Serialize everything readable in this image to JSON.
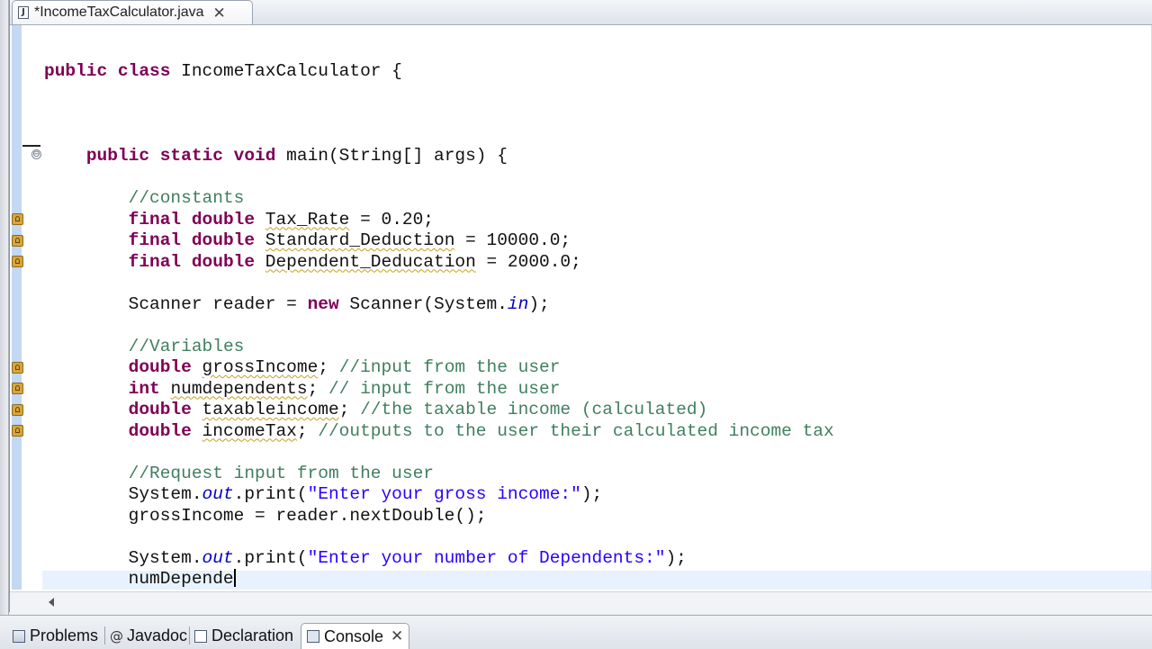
{
  "editor": {
    "tab": {
      "title": "*IncomeTaxCalculator.java",
      "icon": "java-file-icon",
      "close": "✕"
    },
    "fold_glyph": "⊖",
    "code_lines": [
      [
        {
          "t": "public",
          "c": "kw"
        },
        {
          "t": " "
        },
        {
          "t": "class",
          "c": "kw"
        },
        {
          "t": " IncomeTaxCalculator {"
        }
      ],
      [],
      [],
      [],
      [
        {
          "t": "    "
        },
        {
          "t": "public",
          "c": "kw"
        },
        {
          "t": " "
        },
        {
          "t": "static",
          "c": "kw"
        },
        {
          "t": " "
        },
        {
          "t": "void",
          "c": "kw"
        },
        {
          "t": " main(String[] args) {"
        }
      ],
      [],
      [
        {
          "t": "        "
        },
        {
          "t": "//constants",
          "c": "cm"
        }
      ],
      [
        {
          "t": "        "
        },
        {
          "t": "final",
          "c": "kw"
        },
        {
          "t": " "
        },
        {
          "t": "double",
          "c": "kw"
        },
        {
          "t": " "
        },
        {
          "t": "Tax_Rate",
          "c": "sq"
        },
        {
          "t": " = 0.20;"
        }
      ],
      [
        {
          "t": "        "
        },
        {
          "t": "final",
          "c": "kw"
        },
        {
          "t": " "
        },
        {
          "t": "double",
          "c": "kw"
        },
        {
          "t": " "
        },
        {
          "t": "Standard_Deduction",
          "c": "sq"
        },
        {
          "t": " = 10000.0;"
        }
      ],
      [
        {
          "t": "        "
        },
        {
          "t": "final",
          "c": "kw"
        },
        {
          "t": " "
        },
        {
          "t": "double",
          "c": "kw"
        },
        {
          "t": " "
        },
        {
          "t": "Dependent_Deducation",
          "c": "sq"
        },
        {
          "t": " = 2000.0;"
        }
      ],
      [],
      [
        {
          "t": "        Scanner reader = "
        },
        {
          "t": "new",
          "c": "kw"
        },
        {
          "t": " Scanner(System."
        },
        {
          "t": "in",
          "c": "it"
        },
        {
          "t": ");"
        }
      ],
      [],
      [
        {
          "t": "        "
        },
        {
          "t": "//Variables",
          "c": "cm"
        }
      ],
      [
        {
          "t": "        "
        },
        {
          "t": "double",
          "c": "kw"
        },
        {
          "t": " "
        },
        {
          "t": "grossIncome",
          "c": "sq"
        },
        {
          "t": "; "
        },
        {
          "t": "//input from the user",
          "c": "cm"
        }
      ],
      [
        {
          "t": "        "
        },
        {
          "t": "int",
          "c": "kw"
        },
        {
          "t": " "
        },
        {
          "t": "numdependents",
          "c": "sq"
        },
        {
          "t": "; "
        },
        {
          "t": "// input from the user",
          "c": "cm"
        }
      ],
      [
        {
          "t": "        "
        },
        {
          "t": "double",
          "c": "kw"
        },
        {
          "t": " "
        },
        {
          "t": "taxableincome",
          "c": "sq"
        },
        {
          "t": "; "
        },
        {
          "t": "//the taxable income (calculated)",
          "c": "cm"
        }
      ],
      [
        {
          "t": "        "
        },
        {
          "t": "double",
          "c": "kw"
        },
        {
          "t": " "
        },
        {
          "t": "incomeTax",
          "c": "sq"
        },
        {
          "t": "; "
        },
        {
          "t": "//outputs to the user their calculated income tax",
          "c": "cm"
        }
      ],
      [],
      [
        {
          "t": "        "
        },
        {
          "t": "//Request input from the user",
          "c": "cm"
        }
      ],
      [
        {
          "t": "        System."
        },
        {
          "t": "out",
          "c": "it"
        },
        {
          "t": ".print("
        },
        {
          "t": "\"Enter your gross income:\"",
          "c": "st"
        },
        {
          "t": ");"
        }
      ],
      [
        {
          "t": "        grossIncome = reader.nextDouble();"
        }
      ],
      [],
      [
        {
          "t": "        System."
        },
        {
          "t": "out",
          "c": "it"
        },
        {
          "t": ".print("
        },
        {
          "t": "\"Enter your number of Dependents:\"",
          "c": "st"
        },
        {
          "t": ");"
        }
      ],
      [
        {
          "t": "        numDepende"
        },
        {
          "caret": true
        }
      ]
    ]
  },
  "views": {
    "tabs": [
      {
        "label": "Problems",
        "icon": "problems-icon"
      },
      {
        "label": "Javadoc",
        "icon": "javadoc-icon",
        "glyph": "@"
      },
      {
        "label": "Declaration",
        "icon": "declaration-icon"
      },
      {
        "label": "Console",
        "icon": "console-icon",
        "active": true,
        "close": "✕"
      }
    ]
  },
  "colors": {
    "keyword": "#7f0055",
    "comment": "#3f7f5f",
    "string": "#2a00ff",
    "field": "#0000c0",
    "current_line": "#e8f2fe",
    "gutter": "#c3d8f2"
  }
}
